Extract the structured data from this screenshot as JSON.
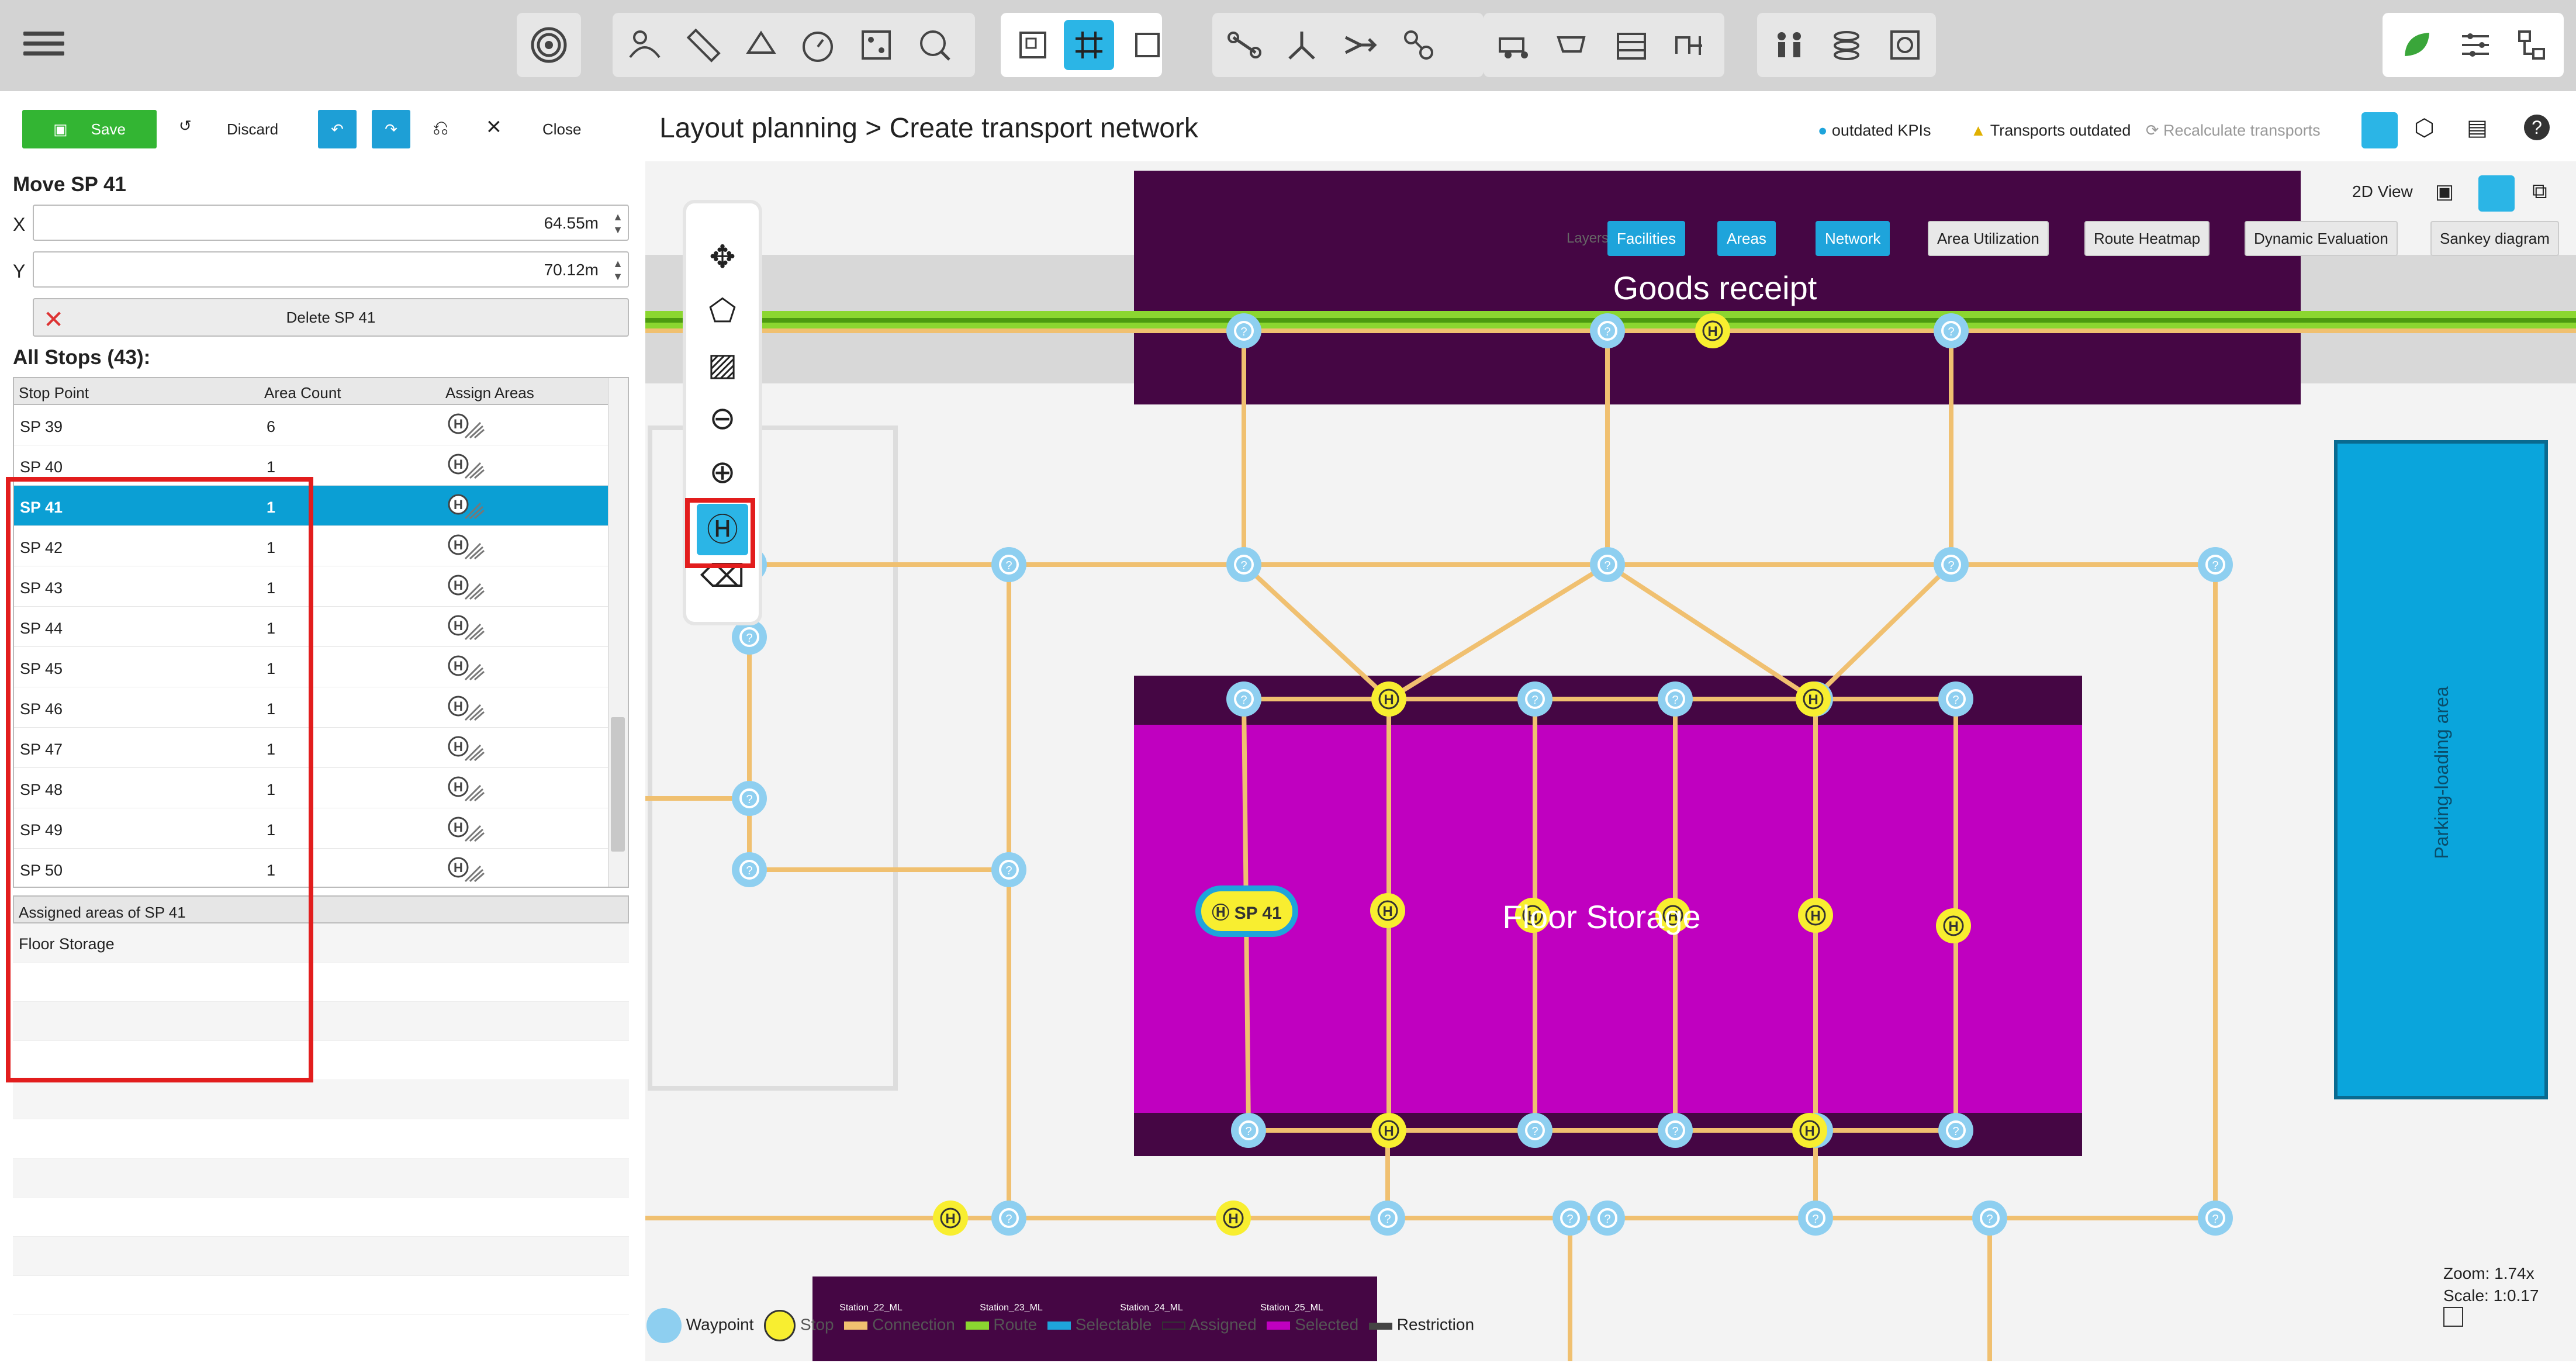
{
  "toolbar": {
    "groups": [
      "view",
      "tools",
      "grid",
      "connect",
      "transport",
      "people"
    ]
  },
  "left": {
    "save": "Save",
    "discard": "Discard",
    "close": "Close",
    "move_title": "Move SP 41",
    "x_label": "X",
    "x_value": "64.55m",
    "y_label": "Y",
    "y_value": "70.12m",
    "delete_label": "Delete SP 41",
    "all_stops": "All Stops (43):",
    "columns": [
      "Stop Point",
      "Area Count",
      "Assign Areas"
    ],
    "rows": [
      {
        "name": "SP 39",
        "count": "6"
      },
      {
        "name": "SP 40",
        "count": "1"
      },
      {
        "name": "SP 41",
        "count": "1"
      },
      {
        "name": "SP 42",
        "count": "1"
      },
      {
        "name": "SP 43",
        "count": "1"
      },
      {
        "name": "SP 44",
        "count": "1"
      },
      {
        "name": "SP 45",
        "count": "1"
      },
      {
        "name": "SP 46",
        "count": "1"
      },
      {
        "name": "SP 47",
        "count": "1"
      },
      {
        "name": "SP 48",
        "count": "1"
      },
      {
        "name": "SP 49",
        "count": "1"
      },
      {
        "name": "SP 50",
        "count": "1"
      }
    ],
    "assigned_title": "Assigned areas of SP 41",
    "assigned": [
      "Floor Storage"
    ]
  },
  "crumb": {
    "parent": "Layout planning",
    "sep": ">",
    "current": "Create transport network"
  },
  "status": {
    "kpi": "outdated KPIs",
    "transports": "Transports outdated",
    "recalc": "Recalculate transports"
  },
  "view": {
    "mode": "2D View",
    "layers_label": "Layers"
  },
  "layers": [
    "Facilities",
    "Areas",
    "Network",
    "Area Utilization",
    "Route Heatmap",
    "Dynamic Evaluation",
    "Sankey diagram"
  ],
  "canvas": {
    "goods": "Goods receipt",
    "storage": "Floor Storage",
    "parking": "Parking-loading area",
    "selected_stop": "SP 41",
    "stop_glyph": "H",
    "wp_glyph": "?",
    "stations": [
      "Station_22_ML",
      "Station_23_ML",
      "Station_24_ML",
      "Station_25_ML"
    ]
  },
  "legend": {
    "waypoint": "Waypoint",
    "stop": "Stop",
    "connection": "Connection",
    "route": "Route",
    "selectable": "Selectable",
    "assigned": "Assigned",
    "selected": "Selected",
    "restriction": "Restriction"
  },
  "zoom": {
    "zoom": "Zoom: 1.74x",
    "scale": "Scale: 1:0.17"
  },
  "colors": {
    "accent": "#1ea4db",
    "save": "#33b533",
    "purple_dark": "#450644",
    "magenta": "#c000c0",
    "connection": "#f0c070",
    "waypoint": "#8ecff0",
    "stop": "#f8ee30",
    "parking": "#0aa5dc"
  }
}
